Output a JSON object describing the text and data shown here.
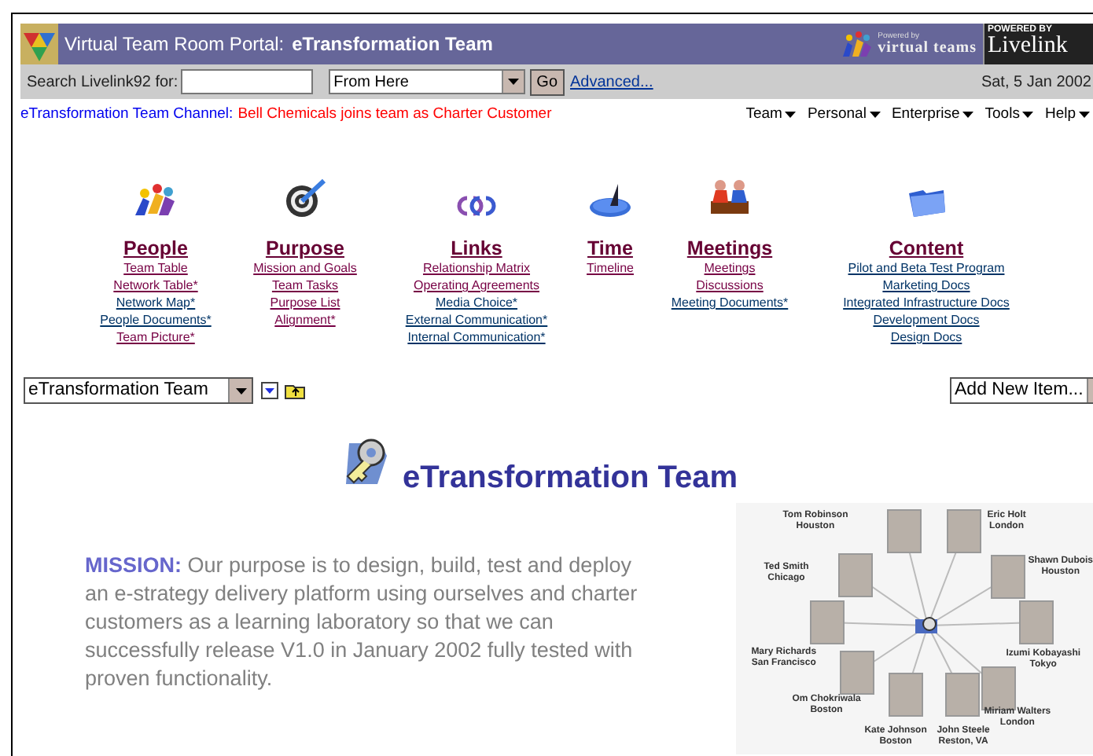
{
  "header": {
    "title_prefix": "Virtual Team Room Portal:",
    "title_team": "eTransformation Team",
    "powered_small": "Powered by",
    "powered_brand": "virtual teams",
    "badge_top": "POWERED BY",
    "badge_brand": "Livelink"
  },
  "search": {
    "label": "Search Livelink92 for:",
    "scope": "From Here",
    "go": "Go",
    "advanced": "Advanced...",
    "date": "Sat, 5 Jan 2002"
  },
  "channel": {
    "label": "eTransformation Team Channel:",
    "message": "Bell Chemicals joins team as Charter Customer"
  },
  "menus": [
    "Team",
    "Personal",
    "Enterprise",
    "Tools",
    "Help"
  ],
  "categories": [
    {
      "title": "People",
      "links": [
        {
          "text": "Team Table",
          "visited": true
        },
        {
          "text": "Network Table*",
          "visited": true
        },
        {
          "text": "Network Map*",
          "visited": false
        },
        {
          "text": "People Documents*",
          "visited": false
        },
        {
          "text": "Team Picture*",
          "visited": true
        }
      ]
    },
    {
      "title": "Purpose",
      "links": [
        {
          "text": "Mission and Goals",
          "visited": true
        },
        {
          "text": "Team Tasks",
          "visited": true
        },
        {
          "text": "Purpose List",
          "visited": true
        },
        {
          "text": "Alignment*",
          "visited": true
        }
      ]
    },
    {
      "title": "Links",
      "links": [
        {
          "text": "Relationship Matrix",
          "visited": true
        },
        {
          "text": "Operating Agreements",
          "visited": true
        },
        {
          "text": "Media Choice*",
          "visited": false
        },
        {
          "text": "External Communication*",
          "visited": false
        },
        {
          "text": "Internal Communication*",
          "visited": false
        }
      ]
    },
    {
      "title": "Time",
      "links": [
        {
          "text": "Timeline",
          "visited": true
        }
      ]
    },
    {
      "title": "Meetings",
      "links": [
        {
          "text": "Meetings",
          "visited": true
        },
        {
          "text": "Discussions",
          "visited": true
        },
        {
          "text": "Meeting Documents*",
          "visited": false
        }
      ]
    },
    {
      "title": "Content",
      "links": [
        {
          "text": "Pilot and Beta Test Program",
          "visited": false
        },
        {
          "text": "Marketing Docs",
          "visited": false
        },
        {
          "text": "Integrated Infrastructure Docs",
          "visited": false
        },
        {
          "text": "Development Docs",
          "visited": false
        },
        {
          "text": "Design Docs",
          "visited": false
        }
      ]
    }
  ],
  "toolbar": {
    "location": "eTransformation Team",
    "add_item": "Add New Item..."
  },
  "team_title": "eTransformation Team",
  "mission": {
    "label": "MISSION:",
    "text": "Our purpose is to design, build, test and deploy an e-strategy delivery platform using ourselves and charter customers as a learning laboratory so that we can successfully release V1.0 in January 2002 fully tested with proven functionality."
  },
  "network": {
    "nodes": [
      {
        "name": "Tom Robinson",
        "city": "Houston"
      },
      {
        "name": "Eric Holt",
        "city": "London"
      },
      {
        "name": "Ted Smith",
        "city": "Chicago"
      },
      {
        "name": "Shawn Dubois",
        "city": "Houston"
      },
      {
        "name": "Mary Richards",
        "city": "San Francisco"
      },
      {
        "name": "Izumi Kobayashi",
        "city": "Tokyo"
      },
      {
        "name": "Om Chokriwala",
        "city": "Boston"
      },
      {
        "name": "Miriam Walters",
        "city": "London"
      },
      {
        "name": "Kate Johnson",
        "city": "Boston"
      },
      {
        "name": "John Steele",
        "city": "Reston, VA"
      }
    ]
  }
}
